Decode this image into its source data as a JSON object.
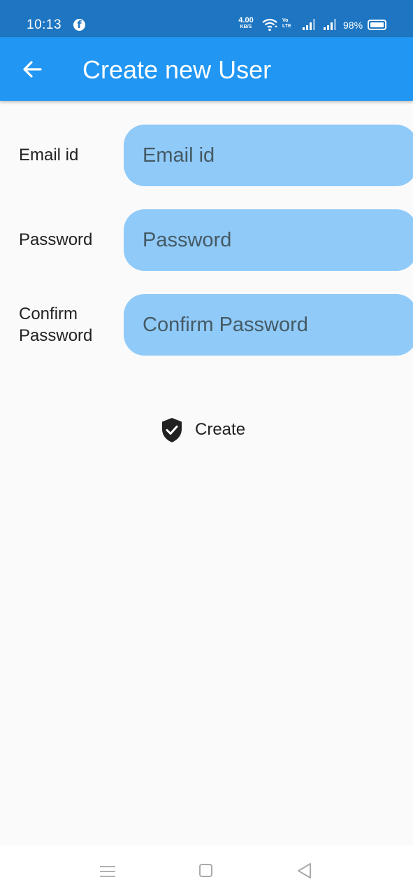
{
  "status_bar": {
    "time": "10:13",
    "app_icon": "facebook-icon",
    "net_speed_value": "4.00",
    "net_speed_unit": "KB/S",
    "volte_top": "Vo",
    "volte_bottom": "LTE",
    "battery_percent": "98%"
  },
  "app_bar": {
    "title": "Create new User",
    "back_icon": "arrow-back-icon"
  },
  "form": {
    "email": {
      "label": "Email id",
      "placeholder": "Email id",
      "value": ""
    },
    "password": {
      "label": "Password",
      "placeholder": "Password",
      "value": ""
    },
    "confirm_password": {
      "label_line1": "Confirm",
      "label_line2": "Password",
      "placeholder": "Confirm Password",
      "value": ""
    }
  },
  "create_button": {
    "label": "Create",
    "icon": "shield-check-icon"
  },
  "colors": {
    "status_bar": "#1e76c2",
    "app_bar": "#2196f3",
    "input_fill": "#90caf9",
    "background": "#fafafa"
  }
}
